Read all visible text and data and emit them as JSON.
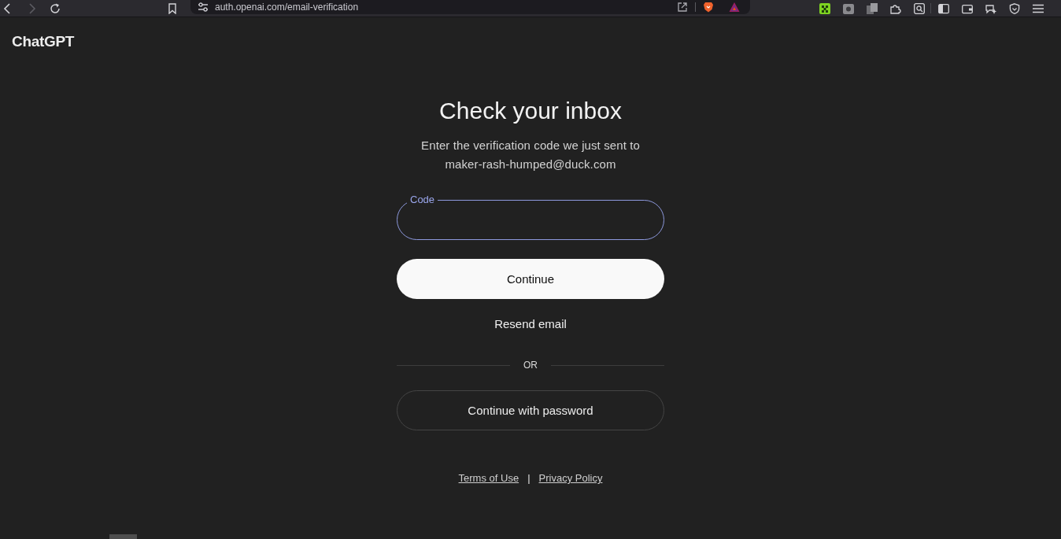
{
  "browser": {
    "nav_buttons": [
      {
        "kind": "back",
        "disabled": false
      },
      {
        "kind": "forward",
        "disabled": true
      },
      {
        "kind": "reload",
        "disabled": false
      }
    ],
    "url": "auth.openai.com/email-verification"
  },
  "header": {
    "logo": "ChatGPT"
  },
  "verification": {
    "title": "Check your inbox",
    "subtitle": "Enter the verification code we just sent to",
    "email": "maker-rash-humped@duck.com",
    "code_field": {
      "label": "Code",
      "focused": true
    },
    "primary_button": "Continue",
    "resend_link": "Resend email",
    "divider_text": "OR",
    "secondary_button": "Continue with password"
  },
  "footer": {
    "links": [
      "Terms of Use",
      "Privacy Policy"
    ],
    "separator": "|"
  }
}
